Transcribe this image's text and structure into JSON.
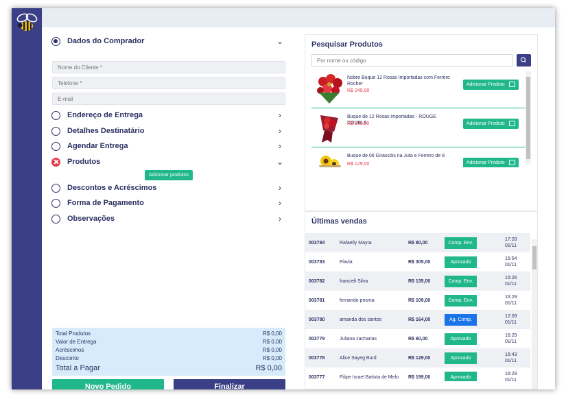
{
  "colors": {
    "sidebar": "#3b3f86",
    "accent_green": "#20b88a",
    "accent_blue": "#1a73e8",
    "error": "#e53a4a",
    "text": "#2c3063"
  },
  "logo": {
    "icon": "bee-icon"
  },
  "buyer": {
    "title": "Dados do Comprador",
    "name_placeholder": "Nome do Cliente *",
    "phone_placeholder": "Telefone *",
    "email_placeholder": "E-mail"
  },
  "sections": {
    "delivery_address": "Endereço de Entrega",
    "recipient_details": "Detalhes Destinatário",
    "schedule_delivery": "Agendar Entrega",
    "products": "Produtos",
    "add_products_button": "Adicionar produtos",
    "discounts": "Descontos e Acréscimos",
    "payment": "Forma de Pagamento",
    "notes": "Observações"
  },
  "totals": {
    "products_label": "Total Produtos",
    "products_value": "R$ 0,00",
    "delivery_label": "Valor de Entrega",
    "delivery_value": "R$ 0,00",
    "additions_label": "Acréscimos",
    "additions_value": "R$ 0,00",
    "discount_label": "Desconto",
    "discount_value": "R$ 0,00",
    "total_label": "Total a Pagar",
    "total_value": "R$ 0,00"
  },
  "actions": {
    "new_order": "Novo Pedido",
    "finish": "Finalizar"
  },
  "search": {
    "title": "Pesquisar Produtos",
    "placeholder": "Por nome ou código",
    "products": [
      {
        "name": "Nobre Buque 12 Rosas Importadas com Ferrero Rocher",
        "price": "R$ 249,00",
        "button": "Adicionar Produto"
      },
      {
        "name": "Buque de 12 Rosas importadas - ROUGE DOUBLE",
        "price": "R$ 225,00",
        "button": "Adicionar Produto"
      },
      {
        "name": "Buque de 06 Girassóis na Juta e Ferrero de 8",
        "price": "R$ 129,00",
        "button": "Adicionar Produto"
      }
    ]
  },
  "sales": {
    "title": "Últimas vendas",
    "rows": [
      {
        "id": "003784",
        "name": "Rafaelly Mayra",
        "value": "R$ 80,00",
        "status": "Comp. Env.",
        "status_color": "#20b88a",
        "date": "17:28 01/11"
      },
      {
        "id": "003783",
        "name": "Flavia",
        "value": "R$ 305,00",
        "status": "Aprovado",
        "status_color": "#20b88a",
        "date": "15:54 01/11"
      },
      {
        "id": "003782",
        "name": "francieli  Silva",
        "value": "R$ 135,00",
        "status": "Comp. Env.",
        "status_color": "#20b88a",
        "date": "15:26 01/11"
      },
      {
        "id": "003781",
        "name": "fernando prisma",
        "value": "R$ 109,00",
        "status": "Comp. Env.",
        "status_color": "#20b88a",
        "date": "16:29 01/11"
      },
      {
        "id": "003780",
        "name": "amanda  dos santos",
        "value": "R$ 164,00",
        "status": "Ag. Comp.",
        "status_color": "#1a73e8",
        "date": "12:09 01/11"
      },
      {
        "id": "003779",
        "name": "Juliana zacharias",
        "value": "R$ 60,00",
        "status": "Aprovado",
        "status_color": "#20b88a",
        "date": "16:29 01/11"
      },
      {
        "id": "003778",
        "name": "Alice Sayeg Burd",
        "value": "R$ 129,00",
        "status": "Aprovado",
        "status_color": "#20b88a",
        "date": "16:43 01/11"
      },
      {
        "id": "003777",
        "name": "Filipe Israel Batista de Melo",
        "value": "R$ 199,00",
        "status": "Aprovado",
        "status_color": "#20b88a",
        "date": "16:29 01/11"
      }
    ]
  }
}
